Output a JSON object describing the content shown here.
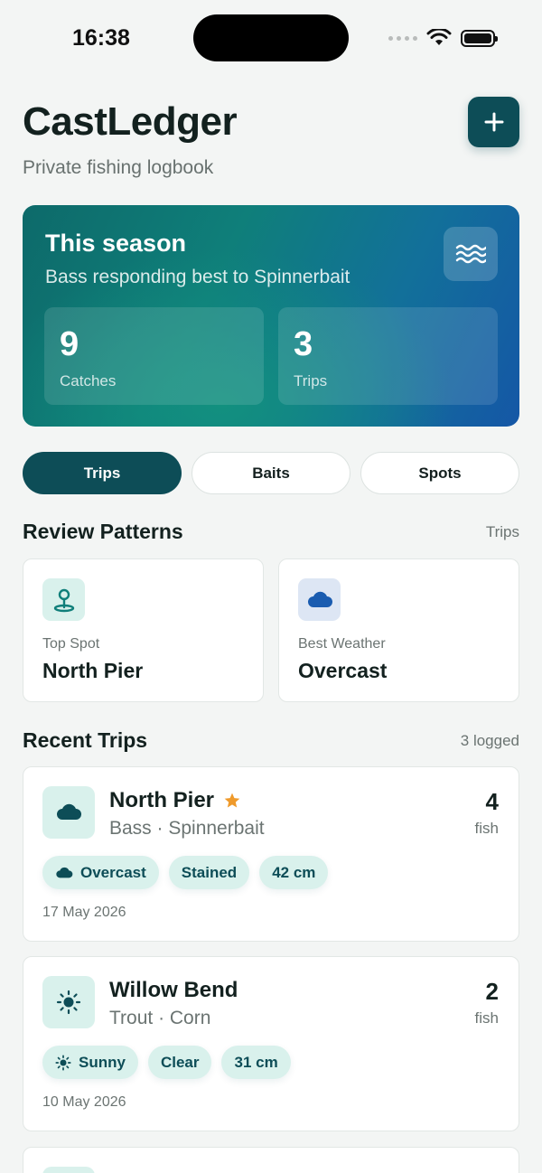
{
  "status": {
    "time": "16:38"
  },
  "header": {
    "title": "CastLedger",
    "subtitle": "Private fishing logbook",
    "add_label": "+"
  },
  "season": {
    "title": "This season",
    "subtitle": "Bass responding best to Spinnerbait",
    "stats": [
      {
        "value": "9",
        "label": "Catches"
      },
      {
        "value": "3",
        "label": "Trips"
      }
    ]
  },
  "tabs": [
    {
      "label": "Trips",
      "active": true
    },
    {
      "label": "Baits",
      "active": false
    },
    {
      "label": "Spots",
      "active": false
    }
  ],
  "patterns": {
    "title": "Review Patterns",
    "meta": "Trips",
    "cards": [
      {
        "label": "Top Spot",
        "value": "North Pier",
        "icon": "map-pin-icon"
      },
      {
        "label": "Best Weather",
        "value": "Overcast",
        "icon": "cloud-icon"
      }
    ]
  },
  "recent": {
    "title": "Recent Trips",
    "meta": "3 logged",
    "trips": [
      {
        "name": "North Pier",
        "favorite": true,
        "meta": "Bass · Spinnerbait",
        "count": "4",
        "count_label": "fish",
        "chips": [
          "Overcast",
          "Stained",
          "42 cm"
        ],
        "date": "17 May 2026",
        "icon": "cloud-icon"
      },
      {
        "name": "Willow Bend",
        "favorite": false,
        "meta": "Trout · Corn",
        "count": "2",
        "count_label": "fish",
        "chips": [
          "Sunny",
          "Clear",
          "31 cm"
        ],
        "date": "10 May 2026",
        "icon": "sun-icon"
      }
    ]
  },
  "colors": {
    "brand": "#0d4d57",
    "accent_star": "#ef9a2b",
    "chip_bg": "#d9f1ec"
  }
}
